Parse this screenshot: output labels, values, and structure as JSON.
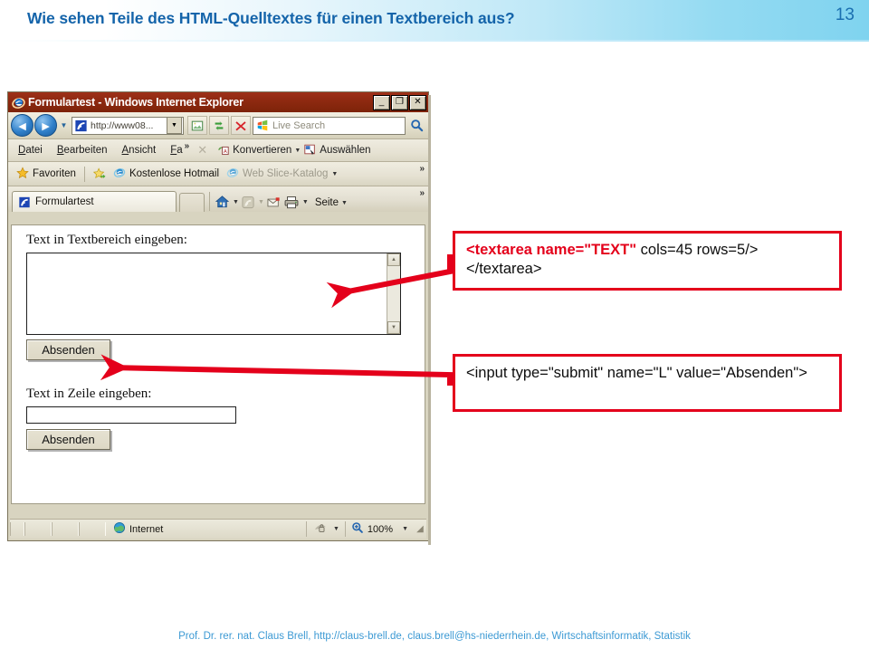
{
  "slide": {
    "title": "Wie sehen Teile des HTML-Quelltextes für einen Textbereich aus?",
    "page_number": "13",
    "footer": "Prof. Dr. rer. nat. Claus Brell, http://claus-brell.de, claus.brell@hs-niederrhein.de, Wirtschaftsinformatik, Statistik",
    "title_color": "#1464aa",
    "footer_color": "#3d9ad4",
    "accent_color": "#e4001b"
  },
  "browser": {
    "window_title": "Formulartest - Windows Internet Explorer",
    "window_buttons": {
      "minimize": "_",
      "maximize": "❐",
      "close": "✕"
    },
    "address_bar": {
      "back_icon": "◄",
      "forward_icon": "►",
      "history_caret": "▼",
      "url": "http://www08...",
      "url_dropdown_caret": "▼",
      "compat_view_title": "compatibility-view",
      "refresh_title": "refresh",
      "stop_title": "stop",
      "search_placeholder": "Live Search"
    },
    "menu_items": [
      {
        "pre": "D",
        "post": "atei"
      },
      {
        "pre": "B",
        "post": "earbeiten"
      },
      {
        "pre": "A",
        "post": "nsicht"
      },
      {
        "pre": "F",
        "post": "a"
      }
    ],
    "menu_overflow": "»",
    "menu_close": "✕",
    "menu_tools": [
      {
        "label": "Konvertieren",
        "caret": "▼"
      },
      {
        "label": "Auswählen",
        "caret": ""
      }
    ],
    "favorites_bar": {
      "favorites_label": "Favoriten",
      "items": [
        {
          "label": "Kostenlose Hotmail",
          "dim": false,
          "caret": ""
        },
        {
          "label": "Web Slice-Katalog",
          "dim": true,
          "caret": "▼"
        }
      ],
      "overflow": "»"
    },
    "tab_bar": {
      "tab_label": "Formulartest",
      "page_menu_label": "Seite",
      "page_menu_caret": "▼",
      "overflow": "»",
      "icons": [
        "home-icon",
        "feed-icon",
        "mail-icon",
        "print-icon"
      ]
    },
    "status_bar": {
      "zone_label": "Internet",
      "security_caret": "▼",
      "zoom_level": "100%",
      "zoom_caret": "▼"
    }
  },
  "page_content": {
    "textarea_label": "Text in Textbereich eingeben:",
    "textarea_value": "",
    "textarea_submit_label": "Absenden",
    "input_label": "Text in Zeile eingeben:",
    "input_value": "",
    "input_submit_label": "Absenden"
  },
  "callouts": [
    {
      "name": "textarea-code",
      "highlight": "<textarea name=\"TEXT\"",
      "rest": " cols=45 rows=5/></textarea>"
    },
    {
      "name": "input-code",
      "highlight": "",
      "rest": "<input type=\"submit\" name=\"L\" value=\"Absenden\">"
    }
  ]
}
